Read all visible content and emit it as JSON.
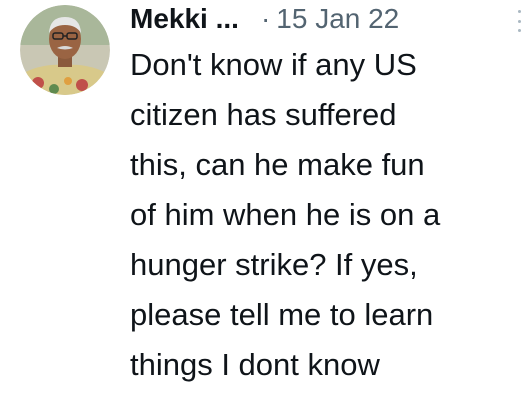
{
  "tweet": {
    "author_name": "Mekki ...",
    "separator": "·",
    "timestamp": "15 Jan 22",
    "more_icon": "more-vertical-icon",
    "text_lines": [
      "Don't know if any US",
      "citizen has suffered",
      "this, can he make fun",
      "of him when he is on a",
      "hunger strike? If yes,",
      "please tell me to learn",
      "things I dont know"
    ]
  }
}
